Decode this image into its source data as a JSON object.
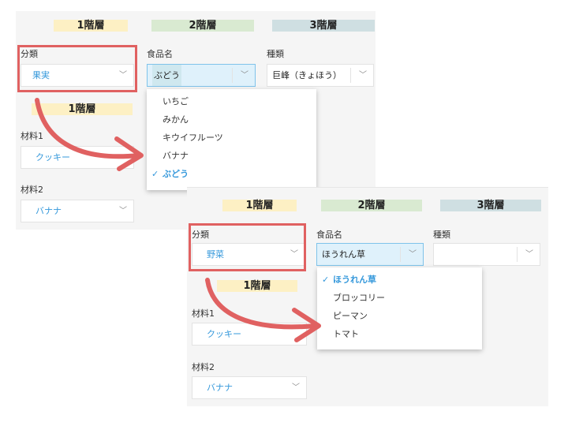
{
  "panel1": {
    "headers": [
      "1階層",
      "2階層",
      "3階層"
    ],
    "sub_header": "1階層",
    "category": {
      "label": "分類",
      "value": "果実"
    },
    "food": {
      "label": "食品名",
      "value": "ぶどう"
    },
    "kind": {
      "label": "種類",
      "value": "巨峰（きょほう）"
    },
    "dropdown": [
      "いちご",
      "みかん",
      "キウイフルーツ",
      "バナナ",
      "ぶどう"
    ],
    "dropdown_selected": "ぶどう",
    "material1": {
      "label": "材料1",
      "value": "クッキー"
    },
    "material2": {
      "label": "材料2",
      "value": "バナナ"
    }
  },
  "panel2": {
    "headers": [
      "1階層",
      "2階層",
      "3階層"
    ],
    "sub_header": "1階層",
    "category": {
      "label": "分類",
      "value": "野菜"
    },
    "food": {
      "label": "食品名",
      "value": "ほうれん草"
    },
    "kind": {
      "label": "種類",
      "value": ""
    },
    "dropdown": [
      "ほうれん草",
      "ブロッコリー",
      "ピーマン",
      "トマト"
    ],
    "dropdown_selected": "ほうれん草",
    "material1": {
      "label": "材料1",
      "value": "クッキー"
    },
    "material2": {
      "label": "材料2",
      "value": "バナナ"
    }
  },
  "icons": {
    "check": "check-icon",
    "chevron": "chevron-down-icon",
    "arrow": "curved-arrow-icon"
  },
  "colors": {
    "accent": "#3498db",
    "highlight_box": "#e06161"
  }
}
